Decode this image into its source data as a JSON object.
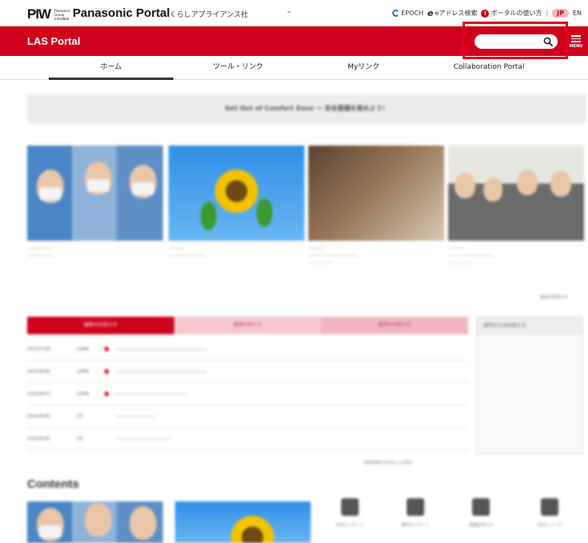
{
  "topbar": {
    "logo_mark": "PIW",
    "logo_sub": [
      "Panasonic",
      "Group",
      "IntraWeb"
    ],
    "brand": "Panasonic Portal",
    "company": "くらしアプライアンス社",
    "links": [
      {
        "label": "EPOCH",
        "icon": "epoch-icon"
      },
      {
        "label": "eアドレス検索",
        "icon": "e-address-icon"
      },
      {
        "label": "ポータルの使い方",
        "icon": "help-icon"
      }
    ],
    "lang_jp": "JP",
    "lang_en": "EN"
  },
  "header": {
    "title": "LAS Portal",
    "search_placeholder": "",
    "menu_label": "MENU"
  },
  "nav": {
    "tabs": [
      "ホーム",
      "ツール・リンク",
      "Myリンク",
      "Collaboration Portal"
    ],
    "active_index": 0
  },
  "body": {
    "banner": "Get Out of Comfort Zone ～ 安全意識を高めよう！",
    "more_link": "最近のお知らせ",
    "news_more": "社内お知らせをもっと見る",
    "contents_title": "Contents",
    "news_tabs": [
      "最新のお知らせ",
      "重要お知らせ",
      "部門のお知らせ"
    ],
    "side_title": "部門からのお知らせ",
    "bottom_icons": [
      "社長メッセージ",
      "部門メッセージ",
      "各種お知らせ",
      "社内ニュース"
    ]
  },
  "colors": {
    "brand_red": "#d0021b",
    "highlight": "#e1001a"
  }
}
